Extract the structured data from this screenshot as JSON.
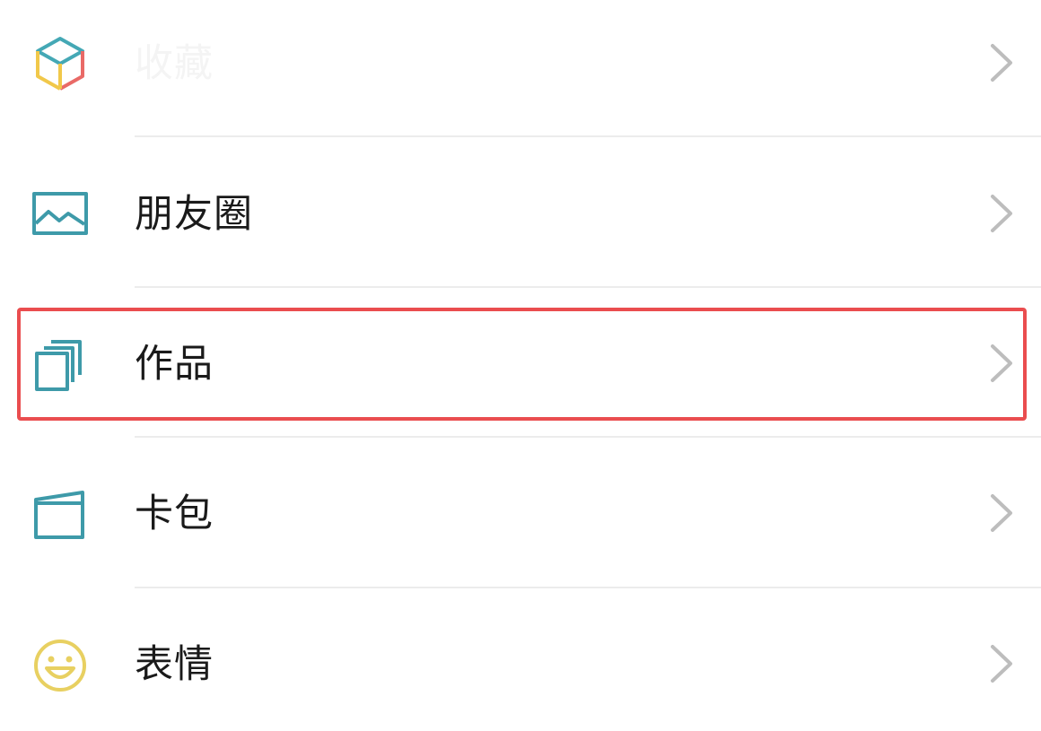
{
  "menu": {
    "items": [
      {
        "icon": "cube-icon",
        "label": "收藏",
        "faded": true
      },
      {
        "icon": "moments-image-icon",
        "label": "朋友圈"
      },
      {
        "icon": "works-stack-icon",
        "label": "作品"
      },
      {
        "icon": "card-wallet-icon",
        "label": "卡包"
      },
      {
        "icon": "smiley-face-icon",
        "label": "表情"
      }
    ]
  },
  "highlight": {
    "target": "作品",
    "color": "#EA4D4F"
  },
  "colors": {
    "cube_yellow": "#F1C84A",
    "cube_red": "#E96A67",
    "cube_teal": "#44A8B5",
    "teal": "#3E9AA9",
    "smiley": "#E8D061",
    "chevron": "#BDBDBD",
    "divider": "#ECECEC"
  }
}
